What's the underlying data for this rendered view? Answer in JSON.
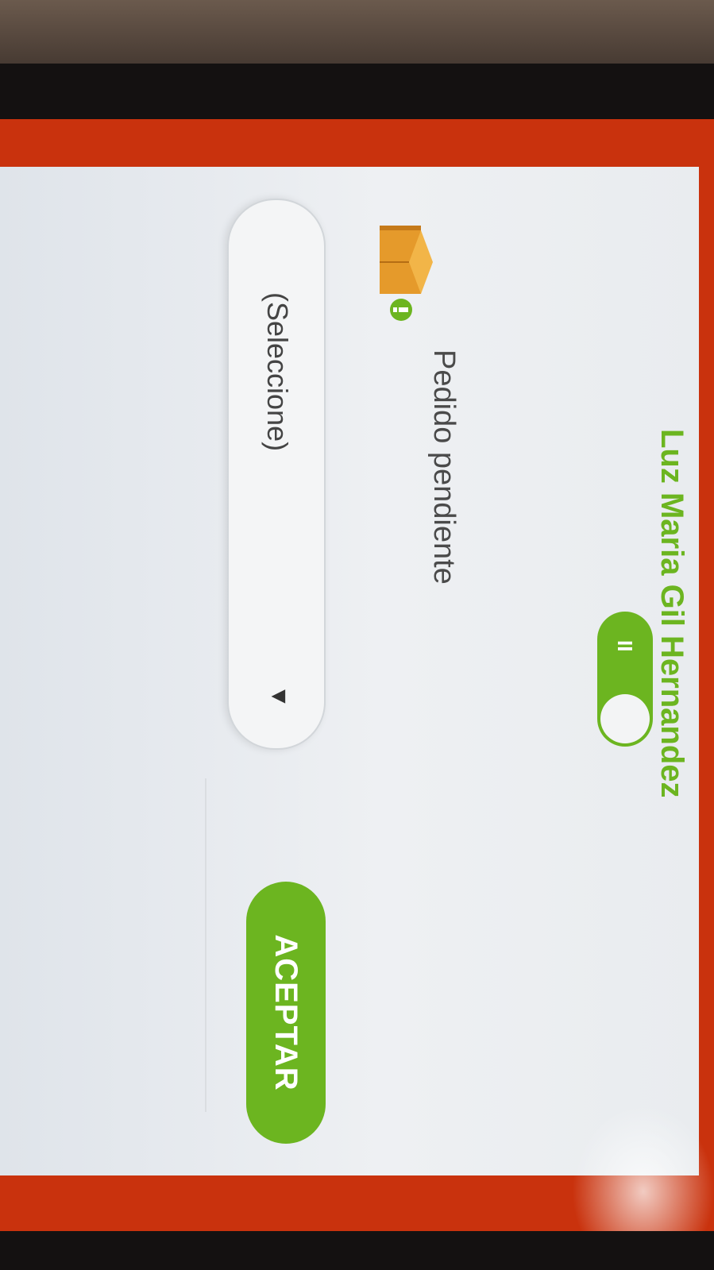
{
  "header": {
    "user_name": "Luz Maria Gil Hernandez",
    "pause_icon": "II"
  },
  "order": {
    "status_label": "Pedido pendiente",
    "status_icon": "open-box-icon"
  },
  "selector": {
    "value": "(Seleccione)",
    "arrow": "▼"
  },
  "actions": {
    "accept_label": "ACEPTAR"
  },
  "colors": {
    "accent": "#6cb520",
    "frame": "#c9320d"
  }
}
